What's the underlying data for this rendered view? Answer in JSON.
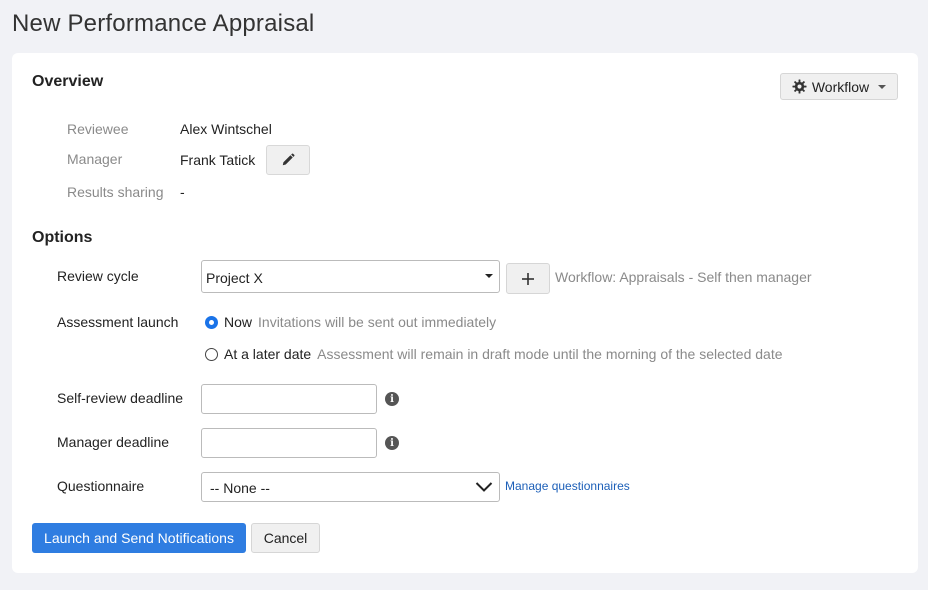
{
  "page": {
    "title": "New Performance Appraisal"
  },
  "overview": {
    "title": "Overview",
    "workflow_button": "Workflow",
    "reviewee_label": "Reviewee",
    "reviewee_value": "Alex Wintschel",
    "manager_label": "Manager",
    "manager_value": "Frank Tatick",
    "results_label": "Results sharing",
    "results_value": "-"
  },
  "options": {
    "title": "Options",
    "review_cycle_label": "Review cycle",
    "review_cycle_value": "Project X",
    "workflow_note": "Workflow: Appraisals - Self then manager",
    "assessment_label": "Assessment launch",
    "radio_now_label": "Now",
    "radio_now_desc": "Invitations will be sent out immediately",
    "radio_later_label": "At a later date",
    "radio_later_desc": "Assessment will remain in draft mode until the morning of the selected date",
    "self_deadline_label": "Self-review deadline",
    "self_deadline_value": "",
    "manager_deadline_label": "Manager deadline",
    "manager_deadline_value": "",
    "questionnaire_label": "Questionnaire",
    "questionnaire_value": "-- None --",
    "manage_link": "Manage questionnaires"
  },
  "actions": {
    "launch_button": "Launch and Send Notifications",
    "cancel_button": "Cancel"
  },
  "colors": {
    "accent": "#2f7de1",
    "link": "#1c5fb8",
    "background": "#f1f2f6"
  },
  "icons": [
    "gear-icon",
    "caret-down-icon",
    "pencil-icon",
    "plus-icon",
    "info-icon",
    "chevron-down-icon"
  ]
}
